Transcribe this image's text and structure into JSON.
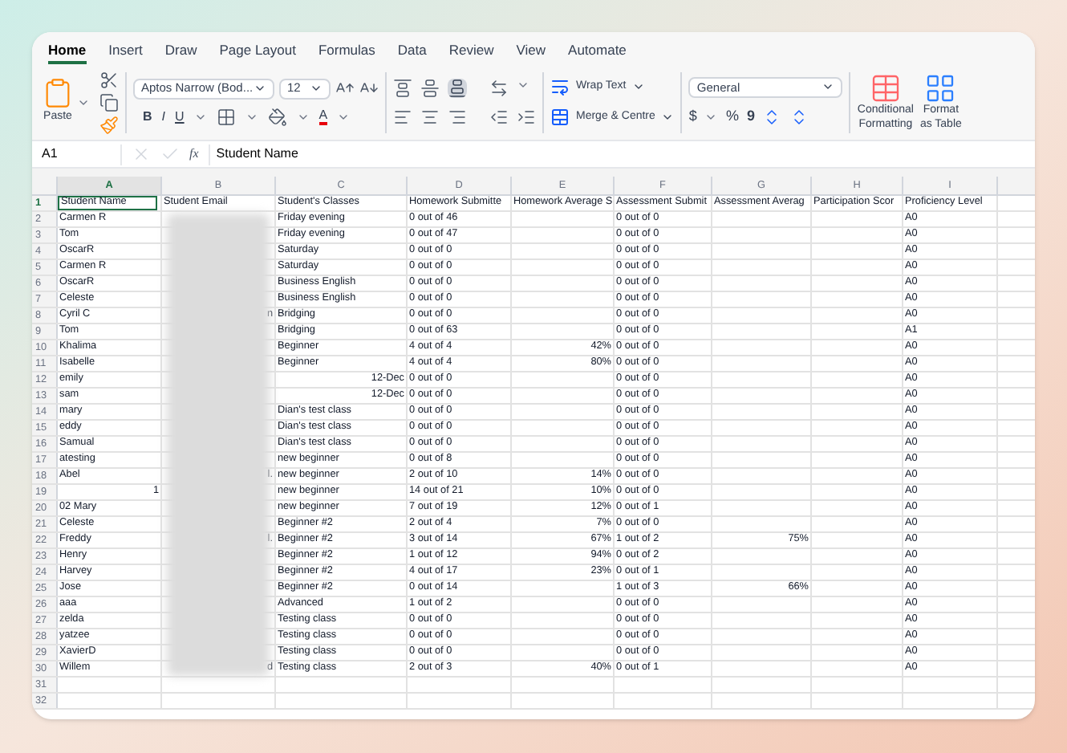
{
  "tabs": [
    {
      "label": "Home",
      "selected": true
    },
    {
      "label": "Insert",
      "selected": false
    },
    {
      "label": "Draw",
      "selected": false
    },
    {
      "label": "Page Layout",
      "selected": false
    },
    {
      "label": "Formulas",
      "selected": false
    },
    {
      "label": "Data",
      "selected": false
    },
    {
      "label": "Review",
      "selected": false
    },
    {
      "label": "View",
      "selected": false
    },
    {
      "label": "Automate",
      "selected": false
    }
  ],
  "ribbon": {
    "paste": "Paste",
    "font": "Aptos Narrow (Bod...",
    "font_size": "12",
    "bold": "B",
    "italic": "I",
    "underline": "U",
    "font_color": "A",
    "wrap_text": "Wrap Text",
    "merge": "Merge & Centre",
    "number_format": "General",
    "currency": "$",
    "percent": "%",
    "comma": "9",
    "conditional_formatting": [
      "Conditional",
      "Formatting"
    ],
    "format_as_table": [
      "Format",
      "as Table"
    ]
  },
  "formula_bar": {
    "name_box": "A1",
    "fx": "fx",
    "value": "Student Name"
  },
  "table": {
    "columns": [
      {
        "label": "A",
        "selected": true
      },
      {
        "label": "B",
        "selected": false
      },
      {
        "label": "C",
        "selected": false
      },
      {
        "label": "D",
        "selected": false
      },
      {
        "label": "E",
        "selected": false
      },
      {
        "label": "F",
        "selected": false
      },
      {
        "label": "G",
        "selected": false
      },
      {
        "label": "H",
        "selected": false
      },
      {
        "label": "I",
        "selected": false
      }
    ],
    "rows": [
      {
        "number": "1",
        "selected": true,
        "cells": [
          "Student Name",
          "Student Email",
          "Student's Classes",
          "Homework Submitte",
          "Homework Average S",
          "Assessment Submit",
          "Assessment Averag",
          "Participation Scor",
          "Proficiency Level"
        ]
      },
      {
        "number": "2",
        "selected": false,
        "cells": [
          "Carmen R",
          null,
          "Friday evening",
          "0 out of 46",
          null,
          "0 out of 0",
          null,
          null,
          "A0"
        ]
      },
      {
        "number": "3",
        "selected": false,
        "cells": [
          "Tom",
          null,
          "Friday evening",
          "0 out of 47",
          null,
          "0 out of 0",
          null,
          null,
          "A0"
        ]
      },
      {
        "number": "4",
        "selected": false,
        "cells": [
          "OscarR",
          null,
          "Saturday",
          "0 out of 0",
          null,
          "0 out of 0",
          null,
          null,
          "A0"
        ]
      },
      {
        "number": "5",
        "selected": false,
        "cells": [
          "Carmen R",
          null,
          "Saturday",
          "0 out of 0",
          null,
          "0 out of 0",
          null,
          null,
          "A0"
        ]
      },
      {
        "number": "6",
        "selected": false,
        "cells": [
          "OscarR",
          null,
          "Business English",
          "0 out of 0",
          null,
          "0 out of 0",
          null,
          null,
          "A0"
        ]
      },
      {
        "number": "7",
        "selected": false,
        "cells": [
          "Celeste",
          null,
          "Business English",
          "0 out of 0",
          null,
          "0 out of 0",
          null,
          null,
          "A0"
        ]
      },
      {
        "number": "8",
        "selected": false,
        "cells": [
          "Cyril C",
          {
            "text": "n",
            "kind": "number"
          },
          "Bridging",
          "0 out of 0",
          null,
          "0 out of 0",
          null,
          null,
          "A0"
        ]
      },
      {
        "number": "9",
        "selected": false,
        "cells": [
          "Tom",
          null,
          "Bridging",
          "0 out of 63",
          null,
          "0 out of 0",
          null,
          null,
          "A1"
        ]
      },
      {
        "number": "10",
        "selected": false,
        "cells": [
          "Khalima",
          null,
          "Beginner",
          "4 out of 4",
          {
            "text": "42%",
            "kind": "number"
          },
          "0 out of 0",
          null,
          null,
          "A0"
        ]
      },
      {
        "number": "11",
        "selected": false,
        "cells": [
          "Isabelle",
          null,
          "Beginner",
          "4 out of 4",
          {
            "text": "80%",
            "kind": "number"
          },
          "0 out of 0",
          null,
          null,
          "A0"
        ]
      },
      {
        "number": "12",
        "selected": false,
        "cells": [
          "emily",
          null,
          {
            "text": "12-Dec",
            "kind": "number"
          },
          "0 out of 0",
          null,
          "0 out of 0",
          null,
          null,
          "A0"
        ]
      },
      {
        "number": "13",
        "selected": false,
        "cells": [
          "sam",
          null,
          {
            "text": "12-Dec",
            "kind": "number"
          },
          "0 out of 0",
          null,
          "0 out of 0",
          null,
          null,
          "A0"
        ]
      },
      {
        "number": "14",
        "selected": false,
        "cells": [
          "mary",
          null,
          "Dian's test class",
          "0 out of 0",
          null,
          "0 out of 0",
          null,
          null,
          "A0"
        ]
      },
      {
        "number": "15",
        "selected": false,
        "cells": [
          "eddy",
          null,
          "Dian's test class",
          "0 out of 0",
          null,
          "0 out of 0",
          null,
          null,
          "A0"
        ]
      },
      {
        "number": "16",
        "selected": false,
        "cells": [
          "Samual",
          null,
          "Dian's test class",
          "0 out of 0",
          null,
          "0 out of 0",
          null,
          null,
          "A0"
        ]
      },
      {
        "number": "17",
        "selected": false,
        "cells": [
          "atesting",
          null,
          "new beginner",
          "0 out of 8",
          null,
          "0 out of 0",
          null,
          null,
          "A0"
        ]
      },
      {
        "number": "18",
        "selected": false,
        "cells": [
          "Abel",
          {
            "text": "l.",
            "kind": "number"
          },
          "new beginner",
          "2 out of 10",
          {
            "text": "14%",
            "kind": "number"
          },
          "0 out of 0",
          null,
          null,
          "A0"
        ]
      },
      {
        "number": "19",
        "selected": false,
        "cells": [
          {
            "text": "1",
            "kind": "number"
          },
          null,
          "new beginner",
          "14 out of 21",
          {
            "text": "10%",
            "kind": "number"
          },
          "0 out of 0",
          null,
          null,
          "A0"
        ]
      },
      {
        "number": "20",
        "selected": false,
        "cells": [
          "02 Mary",
          null,
          "new beginner",
          "7 out of 19",
          {
            "text": "12%",
            "kind": "number"
          },
          "0 out of 1",
          null,
          null,
          "A0"
        ]
      },
      {
        "number": "21",
        "selected": false,
        "cells": [
          "Celeste",
          null,
          "Beginner #2",
          "2 out of 4",
          {
            "text": "7%",
            "kind": "number"
          },
          "0 out of 0",
          null,
          null,
          "A0"
        ]
      },
      {
        "number": "22",
        "selected": false,
        "cells": [
          "Freddy",
          {
            "text": "l.",
            "kind": "number"
          },
          "Beginner #2",
          "3 out of 14",
          {
            "text": "67%",
            "kind": "number"
          },
          "1 out of 2",
          {
            "text": "75%",
            "kind": "number"
          },
          null,
          "A0"
        ]
      },
      {
        "number": "23",
        "selected": false,
        "cells": [
          "Henry",
          null,
          "Beginner #2",
          "1 out of 12",
          {
            "text": "94%",
            "kind": "number"
          },
          "0 out of 2",
          null,
          null,
          "A0"
        ]
      },
      {
        "number": "24",
        "selected": false,
        "cells": [
          "Harvey",
          null,
          "Beginner #2",
          "4 out of 17",
          {
            "text": "23%",
            "kind": "number"
          },
          "0 out of 1",
          null,
          null,
          "A0"
        ]
      },
      {
        "number": "25",
        "selected": false,
        "cells": [
          "Jose",
          null,
          "Beginner #2",
          "0 out of 14",
          null,
          "1 out of 3",
          {
            "text": "66%",
            "kind": "number"
          },
          null,
          "A0"
        ]
      },
      {
        "number": "26",
        "selected": false,
        "cells": [
          "aaa",
          null,
          "Advanced",
          "1 out of 2",
          null,
          "0 out of 0",
          null,
          null,
          "A0"
        ]
      },
      {
        "number": "27",
        "selected": false,
        "cells": [
          "zelda",
          null,
          "Testing class",
          "0 out of 0",
          null,
          "0 out of 0",
          null,
          null,
          "A0"
        ]
      },
      {
        "number": "28",
        "selected": false,
        "cells": [
          "yatzee",
          null,
          "Testing class",
          "0 out of 0",
          null,
          "0 out of 0",
          null,
          null,
          "A0"
        ]
      },
      {
        "number": "29",
        "selected": false,
        "cells": [
          "XavierD",
          null,
          "Testing class",
          "0 out of 0",
          null,
          "0 out of 0",
          null,
          null,
          "A0"
        ]
      },
      {
        "number": "30",
        "selected": false,
        "cells": [
          "Willem",
          {
            "text": "d",
            "kind": "number"
          },
          "Testing class",
          "2 out of 3",
          {
            "text": "40%",
            "kind": "number"
          },
          "0 out of 1",
          null,
          null,
          "A0"
        ]
      },
      {
        "number": "31",
        "selected": false
      },
      {
        "number": "32",
        "selected": false
      }
    ]
  }
}
